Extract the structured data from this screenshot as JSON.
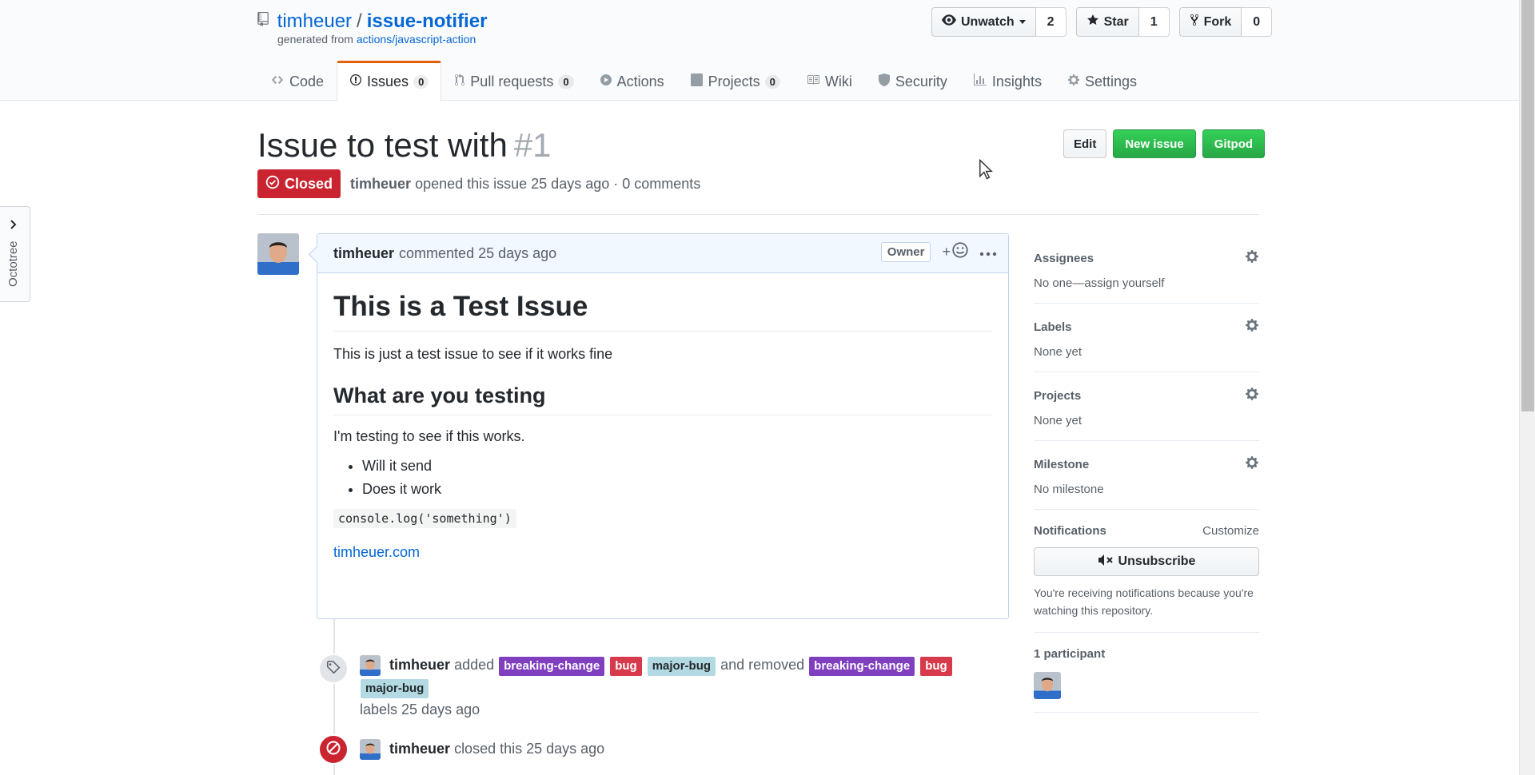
{
  "repo": {
    "owner": "timheuer",
    "separator": "/",
    "name": "issue-notifier",
    "generated_prefix": "generated from",
    "generated_link": "actions/javascript-action"
  },
  "actions": {
    "watch_label": "Unwatch",
    "watch_count": "2",
    "star_label": "Star",
    "star_count": "1",
    "fork_label": "Fork",
    "fork_count": "0"
  },
  "tabs": [
    {
      "label": "Code",
      "icon": "code-icon",
      "count": ""
    },
    {
      "label": "Issues",
      "icon": "issue-opened-icon",
      "count": "0"
    },
    {
      "label": "Pull requests",
      "icon": "git-pull-request-icon",
      "count": "0"
    },
    {
      "label": "Actions",
      "icon": "play-icon",
      "count": ""
    },
    {
      "label": "Projects",
      "icon": "project-icon",
      "count": "0"
    },
    {
      "label": "Wiki",
      "icon": "book-icon",
      "count": ""
    },
    {
      "label": "Security",
      "icon": "shield-icon",
      "count": ""
    },
    {
      "label": "Insights",
      "icon": "graph-icon",
      "count": ""
    },
    {
      "label": "Settings",
      "icon": "gear-icon",
      "count": ""
    }
  ],
  "octotree": {
    "label": "Octotree"
  },
  "issue": {
    "title": "Issue to test with",
    "number": "#1",
    "state": "Closed",
    "author": "timheuer",
    "meta": "opened this issue 25 days ago · 0 comments",
    "edit_label": "Edit",
    "new_issue_label": "New issue",
    "gitpod_label": "Gitpod"
  },
  "comment": {
    "author": "timheuer",
    "time": "commented 25 days ago",
    "badge": "Owner",
    "reaction": "+",
    "h1": "This is a Test Issue",
    "p1": "This is just a test issue to see if it works fine",
    "h2": "What are you testing",
    "p2": "I'm testing to see if this works.",
    "list": [
      "Will it send",
      "Does it work"
    ],
    "code": "console.log('something')",
    "link": "timheuer.com"
  },
  "events": {
    "labeled": {
      "actor": "timheuer",
      "added": "added",
      "and_removed": "and removed",
      "suffix": "labels 25 days ago",
      "labels_added": [
        "breaking-change",
        "bug",
        "major-bug"
      ],
      "labels_removed": [
        "breaking-change",
        "bug",
        "major-bug"
      ]
    },
    "closed": {
      "actor": "timheuer",
      "text": "closed this 25 days ago"
    }
  },
  "sidebar": {
    "assignees": {
      "heading": "Assignees",
      "value": "No one—assign yourself"
    },
    "labels": {
      "heading": "Labels",
      "value": "None yet"
    },
    "projects": {
      "heading": "Projects",
      "value": "None yet"
    },
    "milestone": {
      "heading": "Milestone",
      "value": "No milestone"
    },
    "notifications": {
      "heading": "Notifications",
      "customize": "Customize",
      "button": "Unsubscribe",
      "note": "You're receiving notifications because you're watching this repository."
    },
    "participants": {
      "heading": "1 participant"
    }
  },
  "colors": {
    "link": "#0366d6",
    "closed": "#cb2431",
    "green": "#28a745",
    "label_breaking_change": "#7f3fbf",
    "label_bug": "#d73a4a",
    "label_major_bug": "#b3dae2",
    "tab_accent": "#e36209"
  }
}
